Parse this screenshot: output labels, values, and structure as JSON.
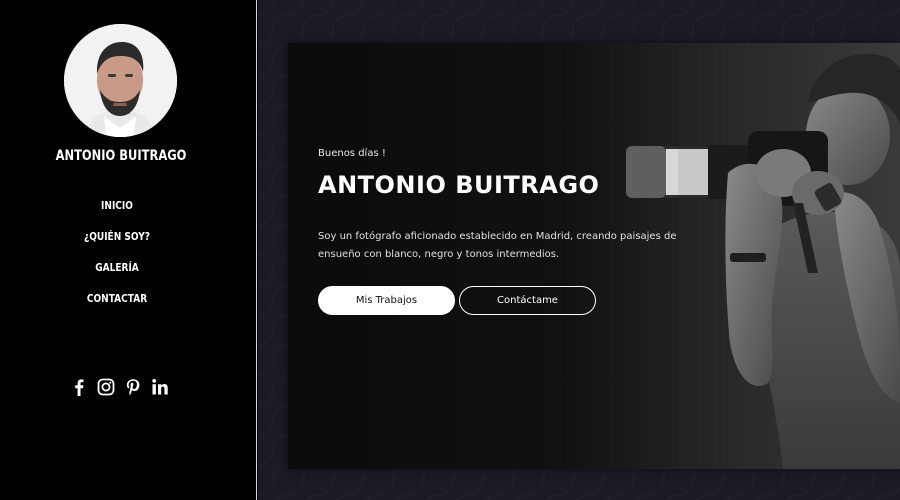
{
  "sidebar": {
    "name": "ANTONIO BUITRAGO",
    "nav": [
      {
        "label": "INICIO"
      },
      {
        "label": "¿QUIÉN SOY?"
      },
      {
        "label": "GALERÍA"
      },
      {
        "label": "CONTACTAR"
      }
    ],
    "socials": [
      {
        "icon": "facebook-icon"
      },
      {
        "icon": "instagram-icon"
      },
      {
        "icon": "pinterest-icon"
      },
      {
        "icon": "linkedin-icon"
      }
    ]
  },
  "hero": {
    "greeting": "Buenos días !",
    "title": "ANTONIO BUITRAGO",
    "description": "Soy un fotógrafo aficionado establecido en Madrid, creando paisajes de ensueño con blanco, negro y tonos intermedios.",
    "primary_button": "Mis Trabajos",
    "secondary_button": "Contáctame"
  },
  "colors": {
    "sidebar_bg": "#000000",
    "main_bg": "#1b1b24",
    "accent": "#ffffff"
  }
}
